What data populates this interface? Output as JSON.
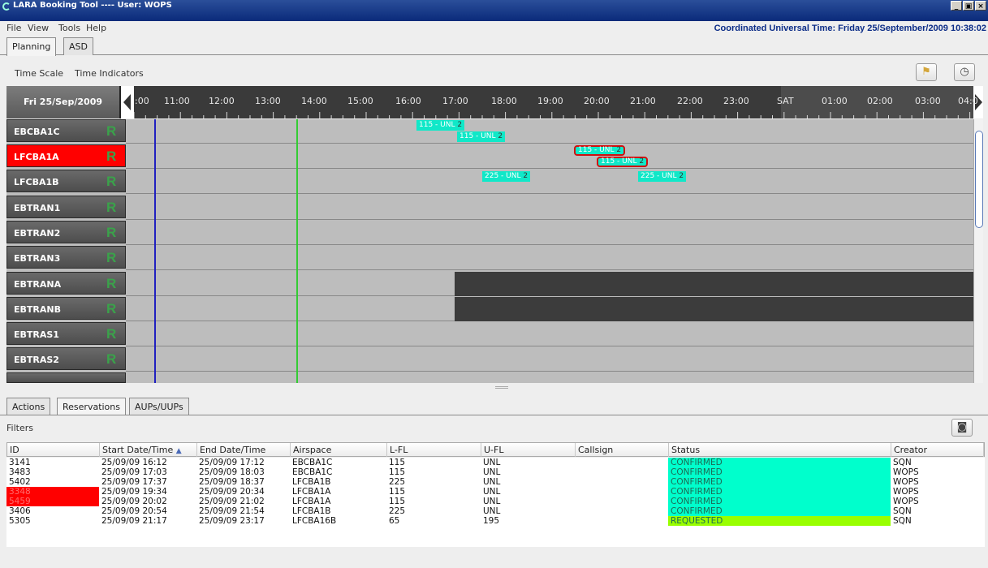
{
  "window": {
    "title": "LARA Booking Tool ---- User: WOPS",
    "controls": [
      "_",
      "×"
    ]
  },
  "menu": {
    "items": [
      "File",
      "View",
      "Tools",
      "Help"
    ]
  },
  "utc_clock": "Coordinated Universal Time: Friday 25/September/2009  10:38:02",
  "tabs": [
    "Planning",
    "ASD"
  ],
  "toolbar": {
    "time_scale": "Time Scale",
    "time_indicators": "Time Indicators"
  },
  "timeline": {
    "date": "Fri 25/Sep/2009",
    "hours": [
      ":00",
      "11:00",
      "12:00",
      "13:00",
      "14:00",
      "15:00",
      "16:00",
      "17:00",
      "18:00",
      "19:00",
      "20:00",
      "21:00",
      "22:00",
      "23:00",
      "SAT",
      "01:00",
      "02:00",
      "03:00",
      "04:0"
    ]
  },
  "rows": [
    {
      "name": "EBCBA1C",
      "flag": "R"
    },
    {
      "name": "LFCBA1A",
      "flag": "R",
      "alert": true
    },
    {
      "name": "LFCBA1B",
      "flag": "R"
    },
    {
      "name": "EBTRAN1",
      "flag": "R"
    },
    {
      "name": "EBTRAN2",
      "flag": "R"
    },
    {
      "name": "EBTRAN3",
      "flag": "R"
    },
    {
      "name": "EBTRANA",
      "flag": "R"
    },
    {
      "name": "EBTRANB",
      "flag": "R"
    },
    {
      "name": "EBTRAS1",
      "flag": "R"
    },
    {
      "name": "EBTRAS2",
      "flag": "R"
    }
  ],
  "bookings": [
    {
      "text": "115 - UNL",
      "suffix": "2"
    },
    {
      "text": "115 - UNL",
      "suffix": "2"
    },
    {
      "text": "115 - UNL",
      "suffix": "2"
    },
    {
      "text": "115 - UNL",
      "suffix": "2"
    },
    {
      "text": "225 - UNL",
      "suffix": "2"
    },
    {
      "text": "225 - UNL",
      "suffix": "2"
    }
  ],
  "bottom_tabs": [
    "Actions",
    "Reservations",
    "AUPs/UUPs"
  ],
  "filters_label": "Filters",
  "table": {
    "headers": [
      "ID",
      "Start Date/Time",
      "End Date/Time",
      "Airspace",
      "L-FL",
      "U-FL",
      "Callsign",
      "Status",
      "Creator"
    ],
    "sort_indicator": "▲",
    "rows": [
      [
        "3141",
        "25/09/09 16:12",
        "25/09/09 17:12",
        "EBCBA1C",
        "115",
        "UNL",
        "",
        "CONFIRMED",
        "SQN"
      ],
      [
        "3483",
        "25/09/09 17:03",
        "25/09/09 18:03",
        "EBCBA1C",
        "115",
        "UNL",
        "",
        "CONFIRMED",
        "WOPS"
      ],
      [
        "5402",
        "25/09/09 17:37",
        "25/09/09 18:37",
        "LFCBA1B",
        "225",
        "UNL",
        "",
        "CONFIRMED",
        "WOPS"
      ],
      [
        "3348",
        "25/09/09 19:34",
        "25/09/09 20:34",
        "LFCBA1A",
        "115",
        "UNL",
        "",
        "CONFIRMED",
        "WOPS"
      ],
      [
        "5459",
        "25/09/09 20:02",
        "25/09/09 21:02",
        "LFCBA1A",
        "115",
        "UNL",
        "",
        "CONFIRMED",
        "WOPS"
      ],
      [
        "3406",
        "25/09/09 20:54",
        "25/09/09 21:54",
        "LFCBA1B",
        "225",
        "UNL",
        "",
        "CONFIRMED",
        "SQN"
      ],
      [
        "5305",
        "25/09/09 21:17",
        "25/09/09 23:17",
        "LFCBA16B",
        "65",
        "195",
        "",
        "REQUESTED",
        "SQN"
      ]
    ],
    "status_colors": {
      "CONFIRMED": "#00ffcc",
      "REQUESTED": "#99ff00"
    },
    "alert_row_color": "#ff0000"
  },
  "colors": {
    "title_bar": "#0a2a7a",
    "alert": "#ff0000",
    "booking": "#10e8c8",
    "flag_green": "#3aa24a"
  }
}
